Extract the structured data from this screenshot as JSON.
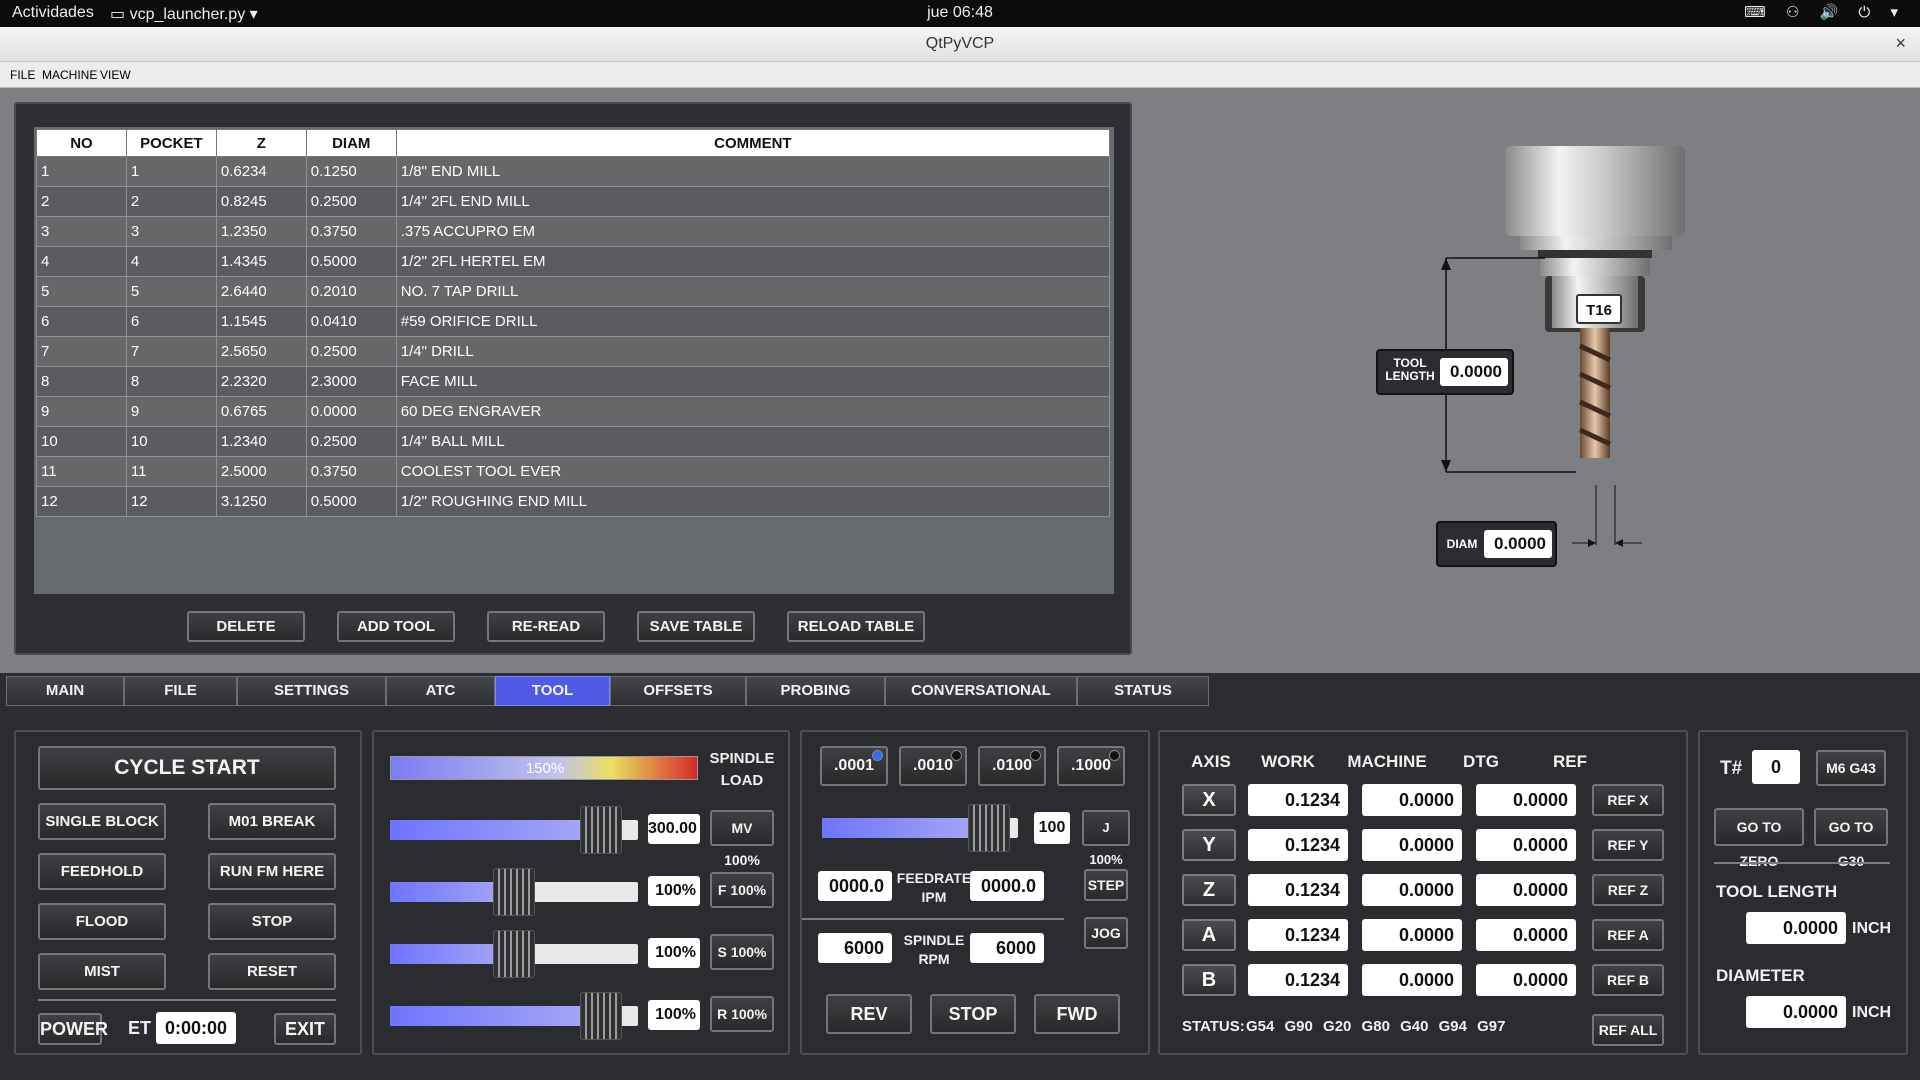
{
  "topbar": {
    "activities": "Actividades",
    "app_menu": "vcp_launcher.py",
    "clock": "jue 06:48",
    "tray": "⌨ ⚇ 🔊 ⏻ ▾"
  },
  "window": {
    "title": "QtPyVCP",
    "close": "×"
  },
  "menu": [
    "FILE",
    "MACHINE",
    "VIEW"
  ],
  "tool_table": {
    "headers": [
      "NO",
      "POCKET",
      "Z",
      "DIAM",
      "COMMENT"
    ],
    "rows": [
      [
        "1",
        "1",
        "0.6234",
        "0.1250",
        "1/8\" END MILL"
      ],
      [
        "2",
        "2",
        "0.8245",
        "0.2500",
        "1/4\" 2FL END MILL"
      ],
      [
        "3",
        "3",
        "1.2350",
        "0.3750",
        ".375 ACCUPRO EM"
      ],
      [
        "4",
        "4",
        "1.4345",
        "0.5000",
        "1/2\" 2FL HERTEL EM"
      ],
      [
        "5",
        "5",
        "2.6440",
        "0.2010",
        "NO. 7 TAP DRILL"
      ],
      [
        "6",
        "6",
        "1.1545",
        "0.0410",
        "#59 ORIFICE DRILL"
      ],
      [
        "7",
        "7",
        "2.5650",
        "0.2500",
        "1/4\" DRILL"
      ],
      [
        "8",
        "8",
        "2.2320",
        "2.3000",
        "FACE MILL"
      ],
      [
        "9",
        "9",
        "0.6765",
        "0.0000",
        "60 DEG ENGRAVER"
      ],
      [
        "10",
        "10",
        "1.2340",
        "0.2500",
        "1/4\" BALL MILL"
      ],
      [
        "11",
        "11",
        "2.5000",
        "0.3750",
        "COOLEST TOOL EVER"
      ],
      [
        "12",
        "12",
        "3.1250",
        "0.5000",
        "1/2\" ROUGHING END MILL"
      ]
    ],
    "buttons": {
      "delete": "DELETE",
      "add": "ADD TOOL",
      "reread": "RE-READ",
      "save": "SAVE TABLE",
      "reload": "RELOAD TABLE"
    }
  },
  "diagram": {
    "tool_no": "T16",
    "tool_length_label_1": "TOOL",
    "tool_length_label_2": "LENGTH",
    "tool_length_value": "0.0000",
    "diam_label": "DIAM",
    "diam_value": "0.0000"
  },
  "tabs": [
    "MAIN",
    "FILE",
    "SETTINGS",
    "ATC",
    "TOOL",
    "OFFSETS",
    "PROBING",
    "CONVERSATIONAL",
    "STATUS"
  ],
  "active_tab": "TOOL",
  "control": {
    "cycle_start": "CYCLE START",
    "single_block": "SINGLE BLOCK",
    "m01_break": "M01 BREAK",
    "feedhold": "FEEDHOLD",
    "run_from_here": "RUN FM HERE",
    "flood": "FLOOD",
    "stop": "STOP",
    "mist": "MIST",
    "reset": "RESET",
    "power": "POWER",
    "et_label": "ET",
    "et_value": "0:00:00",
    "exit": "EXIT"
  },
  "overrides": {
    "spindle_load_label_1": "SPINDLE",
    "spindle_load_label_2": "LOAD",
    "spindle_load_value": "150%",
    "spindle_load_fraction": 0.65,
    "rows": [
      {
        "value": "300.00",
        "button": "MV 100%",
        "fraction": 0.85
      },
      {
        "value": "100%",
        "button": "F 100%",
        "fraction": 0.5
      },
      {
        "value": "100%",
        "button": "S 100%",
        "fraction": 0.5
      },
      {
        "value": "100%",
        "button": "R 100%",
        "fraction": 0.85
      }
    ]
  },
  "jog": {
    "increments": [
      ".0001",
      ".0010",
      ".0100",
      ".1000"
    ],
    "jog_slider_value": "100",
    "jog_slider_fraction": 0.85,
    "jog_button": "J 100%",
    "feed_value": "0000.0",
    "feed_label_1": "FEEDRATE",
    "feed_label_2": "IPM",
    "feed_value2": "0000.0",
    "step": "STEP",
    "jog": "JOG",
    "spindle_value": "6000",
    "spindle_label_1": "SPINDLE",
    "spindle_label_2": "RPM",
    "spindle_value2": "6000",
    "rev": "REV",
    "stop": "STOP",
    "fwd": "FWD"
  },
  "dro": {
    "headers": [
      "AXIS",
      "WORK",
      "MACHINE",
      "DTG",
      "REF"
    ],
    "axes": [
      {
        "axis": "X",
        "work": "0.1234",
        "machine": "0.0000",
        "dtg": "0.0000",
        "ref": "REF X"
      },
      {
        "axis": "Y",
        "work": "0.1234",
        "machine": "0.0000",
        "dtg": "0.0000",
        "ref": "REF Y"
      },
      {
        "axis": "Z",
        "work": "0.1234",
        "machine": "0.0000",
        "dtg": "0.0000",
        "ref": "REF Z"
      },
      {
        "axis": "A",
        "work": "0.1234",
        "machine": "0.0000",
        "dtg": "0.0000",
        "ref": "REF A"
      },
      {
        "axis": "B",
        "work": "0.1234",
        "machine": "0.0000",
        "dtg": "0.0000",
        "ref": "REF B"
      }
    ],
    "status_label": "STATUS:",
    "status_codes": "G54 G90 G20 G80 G40 G94 G97",
    "ref_all": "REF ALL"
  },
  "toolpanel": {
    "t_label": "T#",
    "t_value": "0",
    "m6": "M6 G43",
    "go_zero": "GO TO ZERO",
    "go_g30": "GO TO G30",
    "tool_length_label": "TOOL LENGTH",
    "tool_length_value": "0.0000",
    "unit": "INCH",
    "diameter_label": "DIAMETER",
    "diameter_value": "0.0000",
    "unit2": "INCH"
  },
  "colors": {
    "accent": "#4f5ae6",
    "slider_fill": "#6e74ff"
  }
}
